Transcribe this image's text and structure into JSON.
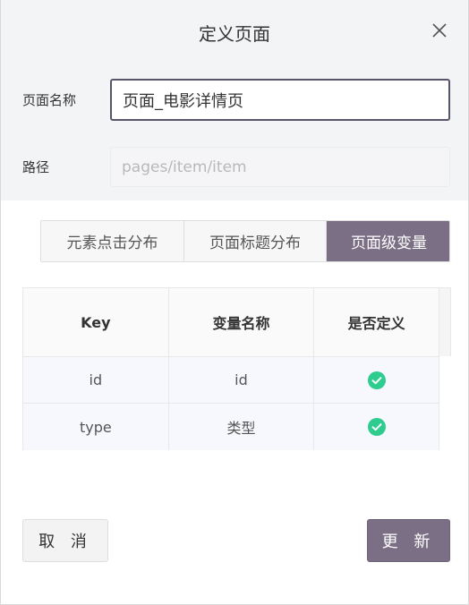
{
  "dialog": {
    "title": "定义页面",
    "close_icon": "close-icon"
  },
  "form": {
    "name_label": "页面名称",
    "name_value": "页面_电影详情页",
    "path_label": "路径",
    "path_placeholder": "pages/item/item"
  },
  "tabs": [
    {
      "label": "元素点击分布",
      "active": false
    },
    {
      "label": "页面标题分布",
      "active": false
    },
    {
      "label": "页面级变量",
      "active": true
    }
  ],
  "table": {
    "columns": [
      "Key",
      "变量名称",
      "是否定义"
    ],
    "rows": [
      {
        "key": "id",
        "name": "id",
        "defined": true,
        "icon": "check-circle-icon"
      },
      {
        "key": "type",
        "name": "类型",
        "defined": true,
        "icon": "check-circle-icon"
      }
    ]
  },
  "buttons": {
    "cancel_label": "取 消",
    "update_label": "更 新"
  },
  "colors": {
    "accent": "#7b6f85",
    "check": "#2ecc8f"
  }
}
